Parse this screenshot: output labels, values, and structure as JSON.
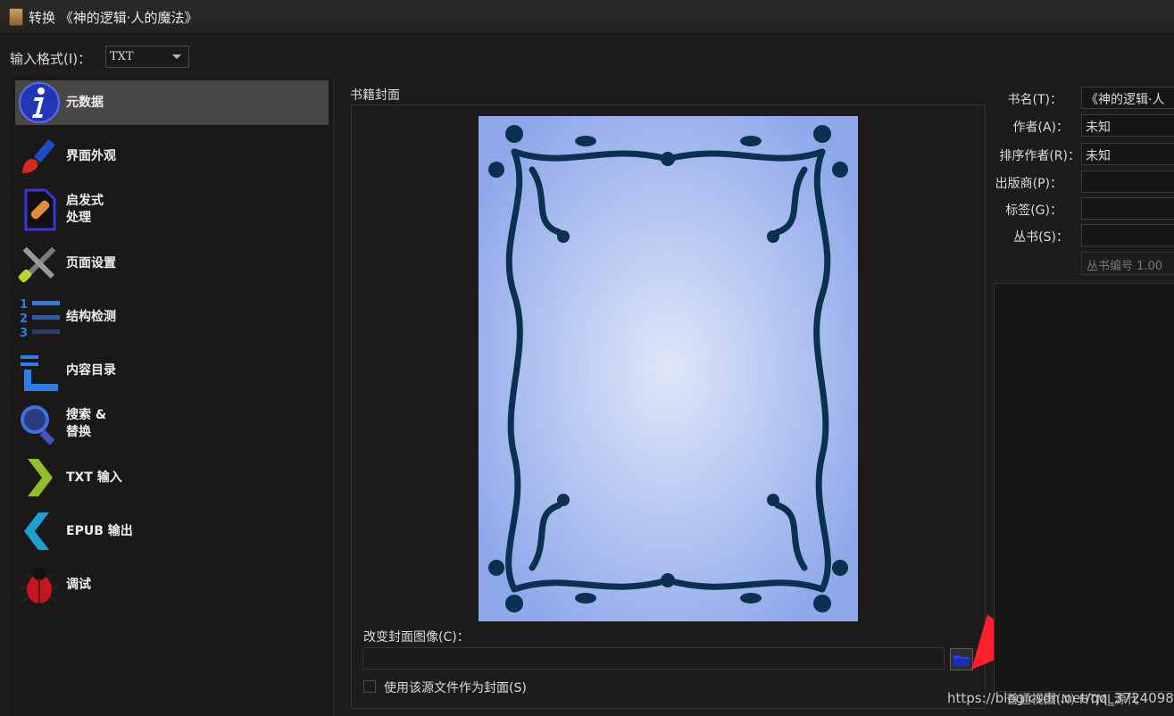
{
  "window": {
    "title": "转换 《神的逻辑·人的魔法》"
  },
  "input_format": {
    "label": "输入格式(I)：",
    "value": "TXT"
  },
  "sidebar": {
    "items": [
      {
        "label": "元数据",
        "icon": "info-icon",
        "active": true
      },
      {
        "label": "界面外观",
        "icon": "paintbrush-icon"
      },
      {
        "label": "启发式\n处理",
        "icon": "bandage-document-icon"
      },
      {
        "label": "页面设置",
        "icon": "tools-icon"
      },
      {
        "label": "结构检测",
        "icon": "numbered-list-icon"
      },
      {
        "label": "内容目录",
        "icon": "toc-icon"
      },
      {
        "label": "搜索 &\n替换",
        "icon": "magnifier-icon"
      },
      {
        "label": "TXT 输入",
        "icon": "chevron-right-icon"
      },
      {
        "label": "EPUB 输出",
        "icon": "chevron-left-icon"
      },
      {
        "label": "调试",
        "icon": "bug-icon"
      }
    ]
  },
  "cover": {
    "caption": "书籍封面",
    "change_label": "改变封面图像(C)：",
    "path_value": "",
    "use_source_label": "使用该源文件作为封面(S)"
  },
  "metadata": {
    "title_label": "书名(T)：",
    "title_value": "《神的逻辑·人",
    "author_label": "作者(A)：",
    "author_value": "未知",
    "author_sort_label": "排序作者(R)：",
    "author_sort_value": "未知",
    "publisher_label": "出版商(P)：",
    "publisher_value": "",
    "tags_label": "标签(G)：",
    "tags_value": "",
    "series_label": "丛书(S)：",
    "series_value": "",
    "series_index": "丛书编号 1.00"
  },
  "bottom": {
    "watermark": "https://blog.csdn.net/qq_37240982",
    "tab_text": "普通视图(N)   HTML源代"
  },
  "colors": {
    "accent": "#ff1f2d",
    "cover_bg": "#8ea8ea",
    "ornament": "#0b3150"
  }
}
